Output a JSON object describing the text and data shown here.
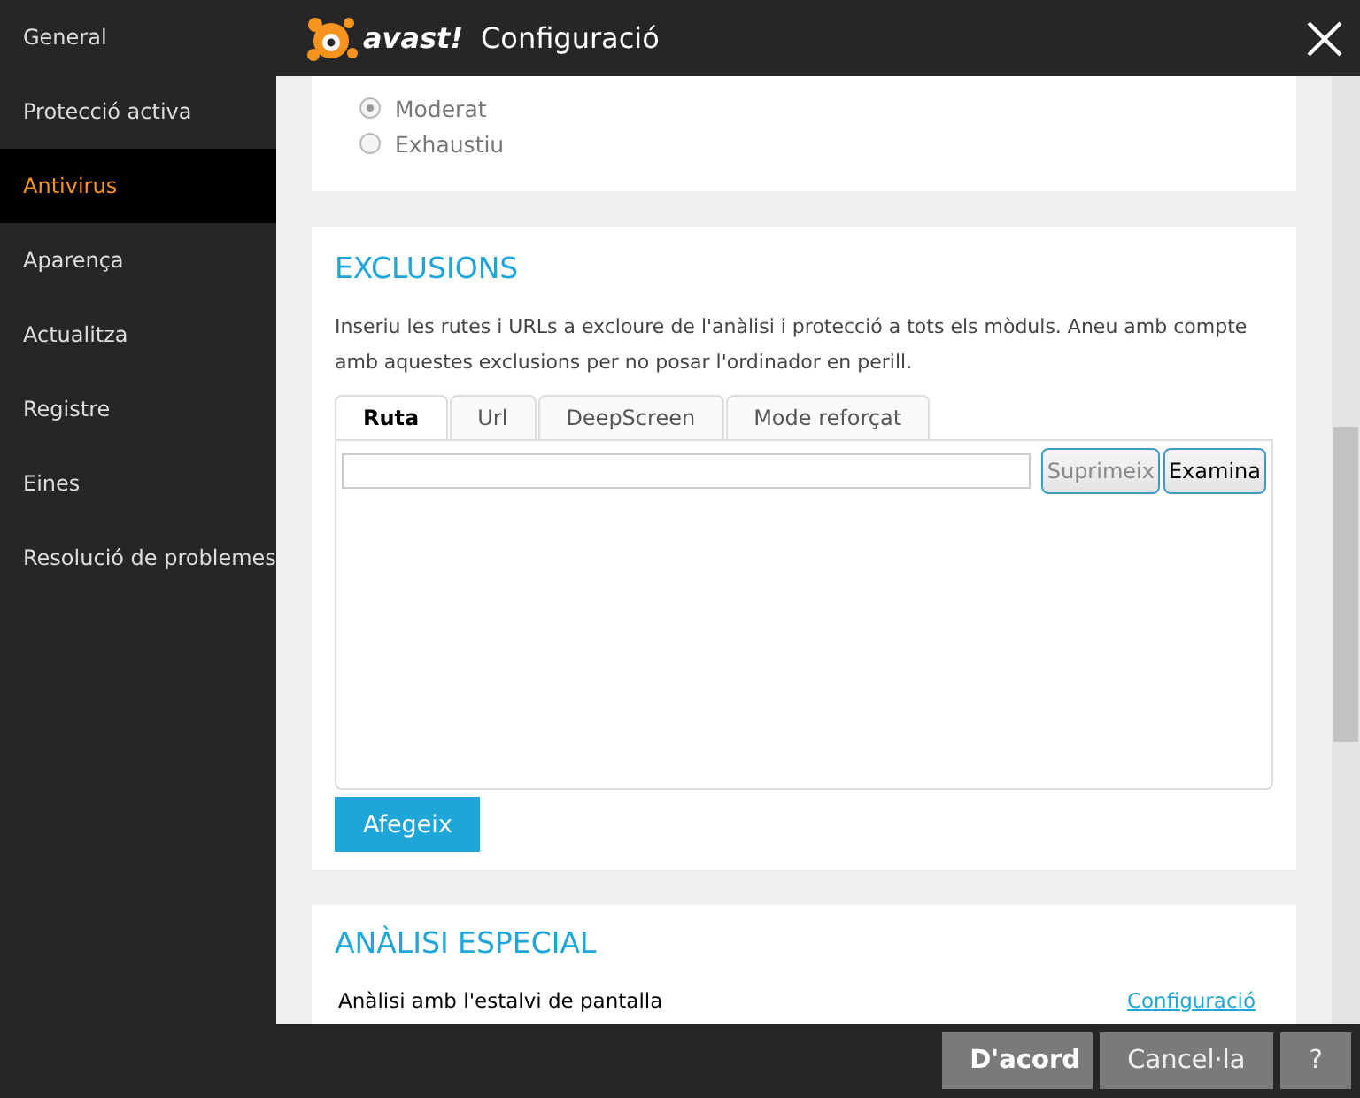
{
  "sidebar": {
    "items": [
      {
        "label": "General",
        "selected": false
      },
      {
        "label": "Protecció activa",
        "selected": false
      },
      {
        "label": "Antivirus",
        "selected": true
      },
      {
        "label": "Aparença",
        "selected": false
      },
      {
        "label": "Actualitza",
        "selected": false
      },
      {
        "label": "Registre",
        "selected": false
      },
      {
        "label": "Eines",
        "selected": false
      },
      {
        "label": "Resolució de problemes",
        "selected": false
      }
    ]
  },
  "header": {
    "logo": "avast!",
    "title": "Configuració"
  },
  "scan_mode": {
    "options": [
      {
        "label": "Moderat",
        "selected": true
      },
      {
        "label": "Exhaustiu",
        "selected": false
      }
    ]
  },
  "exclusions": {
    "heading": "EXCLUSIONS",
    "description": "Inseriu les rutes i URLs a excloure de l'anàlisi i protecció a tots els mòduls. Aneu amb compte amb aquestes exclusions per no posar l'ordinador en perill.",
    "tabs": [
      {
        "label": "Ruta",
        "selected": true
      },
      {
        "label": "Url",
        "selected": false
      },
      {
        "label": "DeepScreen",
        "selected": false
      },
      {
        "label": "Mode reforçat",
        "selected": false
      }
    ],
    "row_buttons": [
      {
        "label": "Suprimeix",
        "disabled": true
      },
      {
        "label": "Examina",
        "disabled": false
      }
    ],
    "add_button": "Afegeix"
  },
  "special_scan": {
    "heading": "ANÀLISI ESPECIAL",
    "rows": [
      {
        "label": "Anàlisi amb l'estalvi de pantalla",
        "link": "Configuració"
      }
    ]
  },
  "footer": {
    "buttons": [
      {
        "label": "D'acord",
        "kind": "primary"
      },
      {
        "label": "Cancel·la",
        "kind": "normal"
      },
      {
        "label": "?",
        "kind": "normal"
      }
    ]
  }
}
